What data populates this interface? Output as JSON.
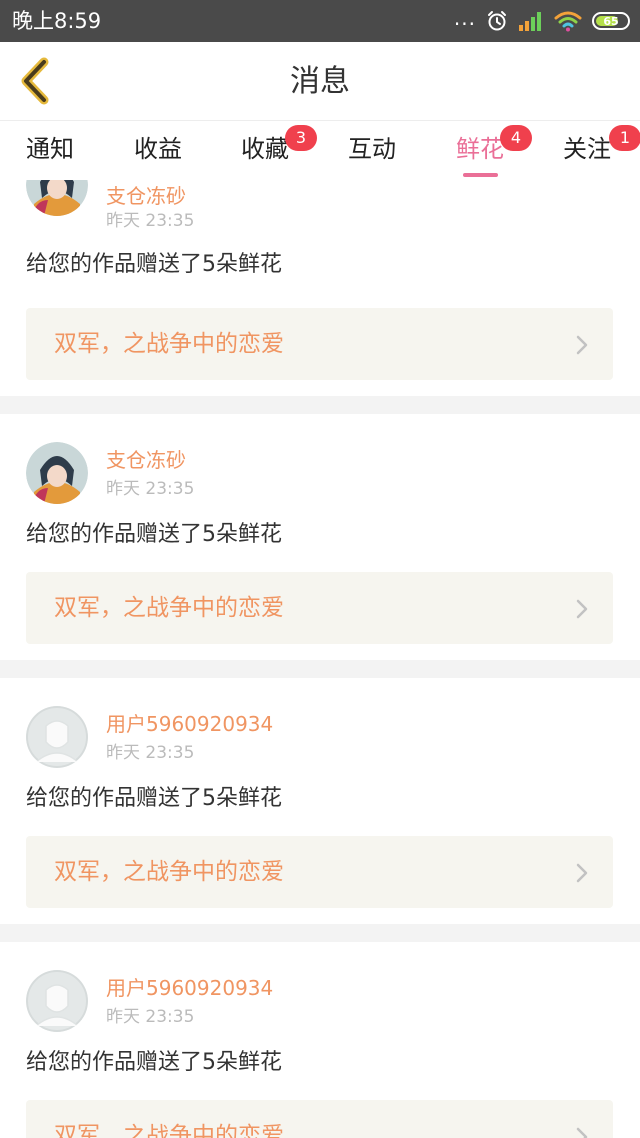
{
  "status_bar": {
    "time": "晚上8:59",
    "dots": "...",
    "battery": "65"
  },
  "header": {
    "title": "消息",
    "back_icon": "chevron-left-icon"
  },
  "tabs": [
    {
      "label": "通知",
      "badge": ""
    },
    {
      "label": "收益",
      "badge": ""
    },
    {
      "label": "收藏",
      "badge": "3"
    },
    {
      "label": "互动",
      "badge": ""
    },
    {
      "label": "鲜花",
      "badge": "4",
      "active": true
    },
    {
      "label": "关注",
      "badge": "1"
    }
  ],
  "colors": {
    "accent": "#ea6f97",
    "username": "#f09562",
    "badge": "#f0404d",
    "work_box_bg": "#f6f5ef"
  },
  "messages": [
    {
      "username": "支仓冻砂",
      "time": "昨天 23:35",
      "text": "给您的作品赠送了5朵鲜花",
      "work_title": "双军，之战争中的恋爱",
      "avatar": "anime-avatar"
    },
    {
      "username": "支仓冻砂",
      "time": "昨天 23:35",
      "text": "给您的作品赠送了5朵鲜花",
      "work_title": "双军，之战争中的恋爱",
      "avatar": "anime-avatar"
    },
    {
      "username": "用户5960920934",
      "time": "昨天 23:35",
      "text": "给您的作品赠送了5朵鲜花",
      "work_title": "双军，之战争中的恋爱",
      "avatar": "default-avatar"
    },
    {
      "username": "用户5960920934",
      "time": "昨天 23:35",
      "text": "给您的作品赠送了5朵鲜花",
      "work_title": "双军，之战争中的恋爱",
      "avatar": "default-avatar"
    }
  ]
}
